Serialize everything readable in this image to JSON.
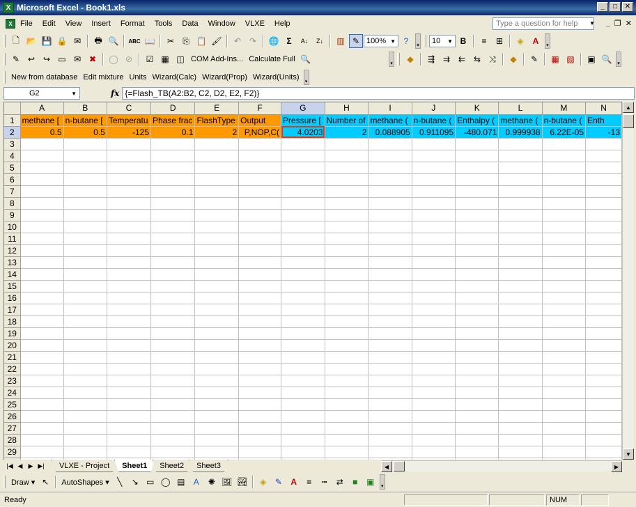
{
  "window": {
    "title": "Microsoft Excel - Book1.xls",
    "app_icon": "X"
  },
  "menu": {
    "items": [
      "File",
      "Edit",
      "View",
      "Insert",
      "Format",
      "Tools",
      "Data",
      "Window",
      "VLXE",
      "Help"
    ],
    "help_placeholder": "Type a question for help"
  },
  "toolbar_standard": {
    "zoom": "100%",
    "font_size": "10",
    "bold": "B",
    "font_color_label": "A"
  },
  "toolbar_addins": {
    "com_addins": "COM Add-Ins...",
    "calculate_full": "Calculate Full"
  },
  "toolbar_vlxe": {
    "items": [
      "New from database",
      "Edit mixture",
      "Units",
      "Wizard(Calc)",
      "Wizard(Prop)",
      "Wizard(Units)"
    ]
  },
  "formula_bar": {
    "name_box": "G2",
    "fx": "fx",
    "formula": "{=Flash_TB(A2:B2, C2, D2, E2, F2)}"
  },
  "sheet": {
    "columns": [
      "A",
      "B",
      "C",
      "D",
      "E",
      "F",
      "G",
      "H",
      "I",
      "J",
      "K",
      "L",
      "M",
      "N"
    ],
    "selected_column": "G",
    "row1": [
      "methane [",
      "n-butane [",
      "Temperatu",
      "Phase frac",
      "FlashType",
      "Output",
      "Pressure [",
      "Number of",
      "methane (",
      "n-butane (",
      "Enthalpy (",
      "methane (",
      "n-butane (",
      "Enth"
    ],
    "row2": [
      "0.5",
      "0.5",
      "-125",
      "0.1",
      "2",
      "P,NOP,C(",
      "4.0203",
      "2",
      "0.088905",
      "0.911095",
      "-480.071",
      "0.999938",
      "6.22E-05",
      "-13"
    ],
    "row_count": 30
  },
  "tabs": {
    "items": [
      "VLXE - Project",
      "Sheet1",
      "Sheet2",
      "Sheet3"
    ],
    "active": "Sheet1"
  },
  "drawing": {
    "draw": "Draw",
    "autoshapes": "AutoShapes"
  },
  "status": {
    "text": "Ready",
    "num": "NUM"
  },
  "colors": {
    "input_header": "#ff9900",
    "output_header": "#00ccff",
    "title_bar": "#0a246a"
  }
}
